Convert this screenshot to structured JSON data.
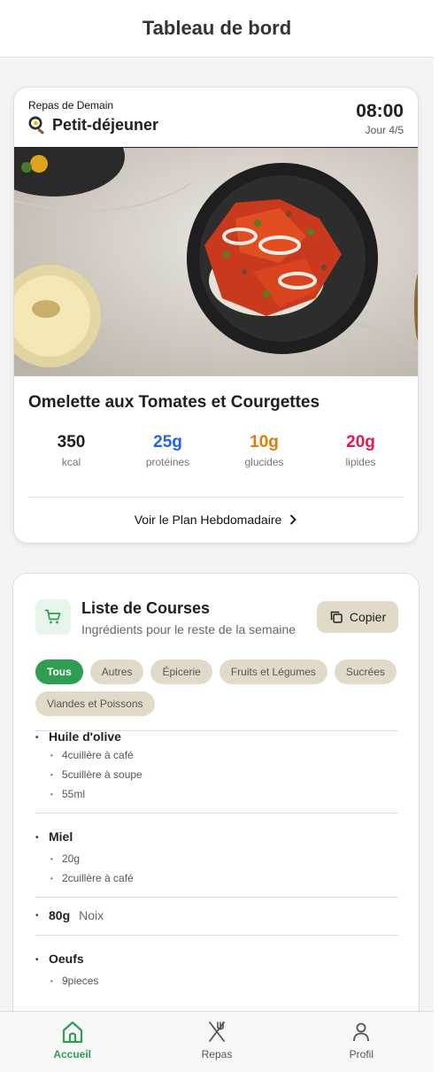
{
  "header": {
    "title": "Tableau de bord"
  },
  "meal": {
    "subtitle": "Repas de Demain",
    "type_label": "Petit-déjeuner",
    "time": "08:00",
    "day": "Jour 4/5",
    "title": "Omelette aux Tomates et Courgettes",
    "stats": [
      {
        "value": "350",
        "label": "kcal",
        "color": "#1f1f1f"
      },
      {
        "value": "25g",
        "label": "protéines",
        "color": "#2463e8"
      },
      {
        "value": "10g",
        "label": "glucides",
        "color": "#e07b0b"
      },
      {
        "value": "20g",
        "label": "lipides",
        "color": "#e3194f"
      }
    ],
    "plan_link": "Voir le Plan Hebdomadaire"
  },
  "shopping": {
    "title": "Liste de Courses",
    "subtitle": "Ingrédients pour le reste de la semaine",
    "copy_label": "Copier",
    "chips": [
      {
        "label": "Tous",
        "active": true
      },
      {
        "label": "Autres",
        "active": false
      },
      {
        "label": "Épicerie",
        "active": false
      },
      {
        "label": "Fruits et Légumes",
        "active": false
      },
      {
        "label": "Sucrées",
        "active": false
      },
      {
        "label": "Viandes et Poissons",
        "active": false
      }
    ],
    "items": {
      "oil": {
        "name": "Huile d'olive",
        "qty": [
          "4cuillère à café",
          "5cuillère à soupe",
          "55ml"
        ]
      },
      "honey": {
        "name": "Miel",
        "qty": [
          "20g",
          "2cuillère à café"
        ]
      },
      "nuts": {
        "amount": "80g",
        "name": "Noix"
      },
      "eggs": {
        "name": "Oeufs",
        "qty": [
          "9pieces"
        ]
      }
    }
  },
  "tabs": [
    {
      "label": "Accueil",
      "icon": "home-icon",
      "active": true
    },
    {
      "label": "Repas",
      "icon": "utensils-icon",
      "active": false
    },
    {
      "label": "Profil",
      "icon": "user-icon",
      "active": false
    }
  ],
  "colors": {
    "accent": "#2f9e52",
    "chip": "#e0dbc8"
  }
}
